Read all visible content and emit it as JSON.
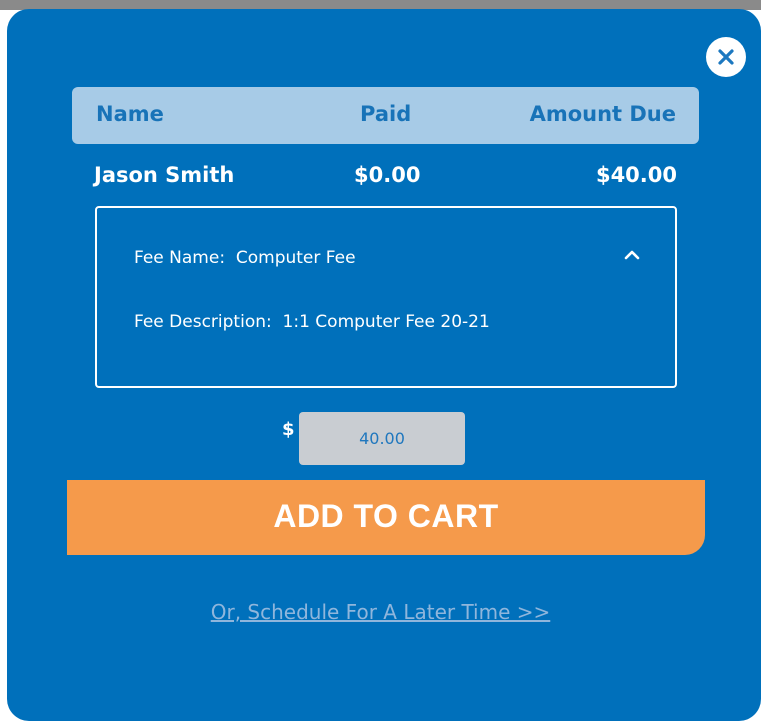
{
  "table": {
    "headers": {
      "name": "Name",
      "paid": "Paid",
      "amount_due": "Amount Due"
    },
    "row": {
      "name": "Jason Smith",
      "paid": "$0.00",
      "amount_due": "$40.00"
    }
  },
  "fee": {
    "name_label": "Fee Name:",
    "name_value": "Computer Fee",
    "description_label": "Fee Description:",
    "description_value": "1:1 Computer Fee 20-21",
    "expanded": true
  },
  "payment": {
    "currency_symbol": "$",
    "amount": "40.00"
  },
  "actions": {
    "add_to_cart": "ADD TO CART",
    "schedule_link": "Or, Schedule For A Later Time >>"
  },
  "icons": {
    "close": "close-icon",
    "collapse": "chevron-up-icon"
  },
  "colors": {
    "modal_bg": "#0070bb",
    "header_bg": "#a7cbe7",
    "header_text": "#1873b8",
    "cart_button": "#f59a4b",
    "input_bg": "#c9cdd2",
    "link": "#8fb6dc"
  }
}
